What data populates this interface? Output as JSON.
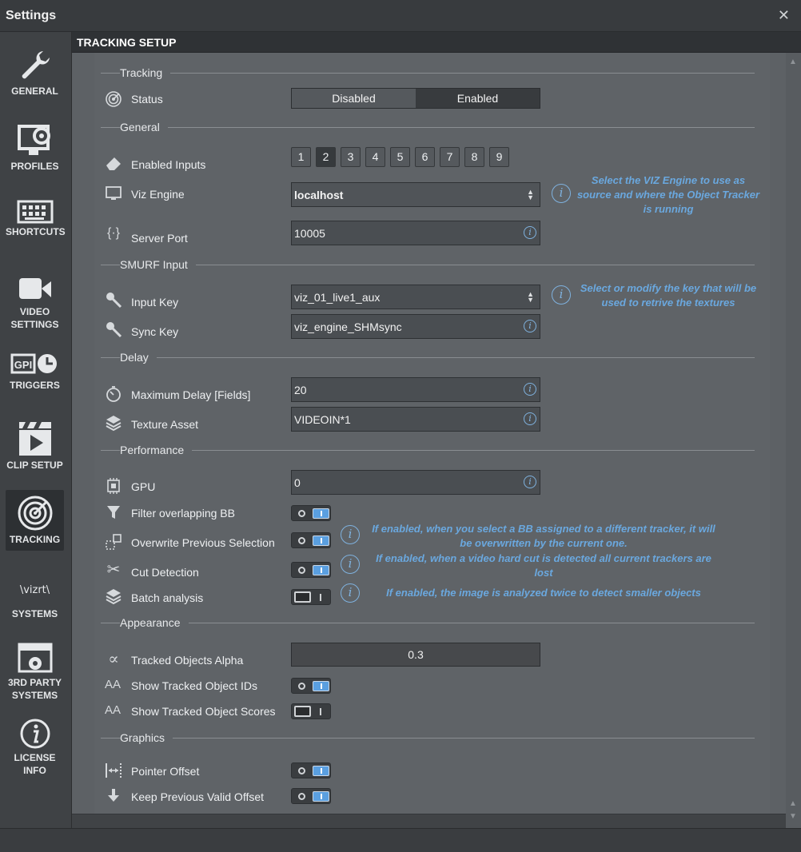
{
  "window": {
    "title": "Settings",
    "close_glyph": "✕"
  },
  "sidebar": {
    "items": [
      {
        "label": "GENERAL",
        "icon": "wrench-icon"
      },
      {
        "label": "PROFILES",
        "icon": "monitor-gear-icon"
      },
      {
        "label": "SHORTCUTS",
        "icon": "keyboard-icon"
      },
      {
        "label": "VIDEO SETTINGS",
        "icon": "video-camera-icon"
      },
      {
        "label": "TRIGGERS",
        "icon": "gpi-clock-icon"
      },
      {
        "label": "CLIP SETUP",
        "icon": "clapperboard-icon"
      },
      {
        "label": "TRACKING",
        "icon": "radar-icon",
        "active": true
      },
      {
        "label": "SYSTEMS",
        "icon": "vizrt-logo-icon"
      },
      {
        "label": "3RD PARTY SYSTEMS",
        "icon": "browser-gear-icon"
      },
      {
        "label": "LICENSE INFO",
        "icon": "info-icon"
      }
    ],
    "vizrt_logo_text": "\\vizrt\\"
  },
  "header": {
    "title": "TRACKING SETUP"
  },
  "sections": {
    "tracking": "Tracking",
    "general": "General",
    "smurf": "SMURF Input",
    "delay": "Delay",
    "performance": "Performance",
    "appearance": "Appearance",
    "graphics": "Graphics"
  },
  "status": {
    "label": "Status",
    "options": [
      "Disabled",
      "Enabled"
    ],
    "selected": "Enabled"
  },
  "enabled_inputs": {
    "label": "Enabled Inputs",
    "buttons": [
      "1",
      "2",
      "3",
      "4",
      "5",
      "6",
      "7",
      "8",
      "9"
    ],
    "selected": "2"
  },
  "viz_engine": {
    "label": "Viz Engine",
    "value": "localhost",
    "help": "Select the VIZ Engine to use as source and where the Object Tracker is running"
  },
  "server_port": {
    "label": "Server Port",
    "value": "10005"
  },
  "input_key": {
    "label": "Input Key",
    "value": "viz_01_live1_aux",
    "help": "Select or modify the key that will be used to retrive the textures"
  },
  "sync_key": {
    "label": "Sync Key",
    "value": "viz_engine_SHMsync"
  },
  "max_delay": {
    "label": "Maximum Delay [Fields]",
    "value": "20"
  },
  "texture_asset": {
    "label": "Texture Asset",
    "value": "VIDEOIN*1"
  },
  "gpu": {
    "label": "GPU",
    "value": "0"
  },
  "filter_bb": {
    "label": "Filter overlapping BB",
    "enabled": true
  },
  "overwrite": {
    "label": "Overwrite Previous Selection",
    "enabled": true,
    "help": "If enabled, when you select a BB assigned to a different tracker, it will be overwritten by the current one."
  },
  "cut_detection": {
    "label": "Cut Detection",
    "enabled": true,
    "help": "If enabled, when a video hard cut is detected all current trackers are lost"
  },
  "batch_analysis": {
    "label": "Batch analysis",
    "enabled": false,
    "help": "If enabled, the image is analyzed twice to detect smaller objects"
  },
  "alpha": {
    "label": "Tracked Objects Alpha",
    "value": "0.3"
  },
  "show_ids": {
    "label": "Show Tracked Object IDs",
    "enabled": true
  },
  "show_scores": {
    "label": "Show Tracked Object Scores",
    "enabled": false
  },
  "pointer_offset": {
    "label": "Pointer Offset",
    "enabled": true
  },
  "keep_offset": {
    "label": "Keep Previous Valid Offset",
    "enabled": true
  },
  "info_glyph": "i",
  "colors": {
    "accent": "#5a9fe0",
    "help_text": "#6aa8df",
    "panel": "#5f6367"
  }
}
